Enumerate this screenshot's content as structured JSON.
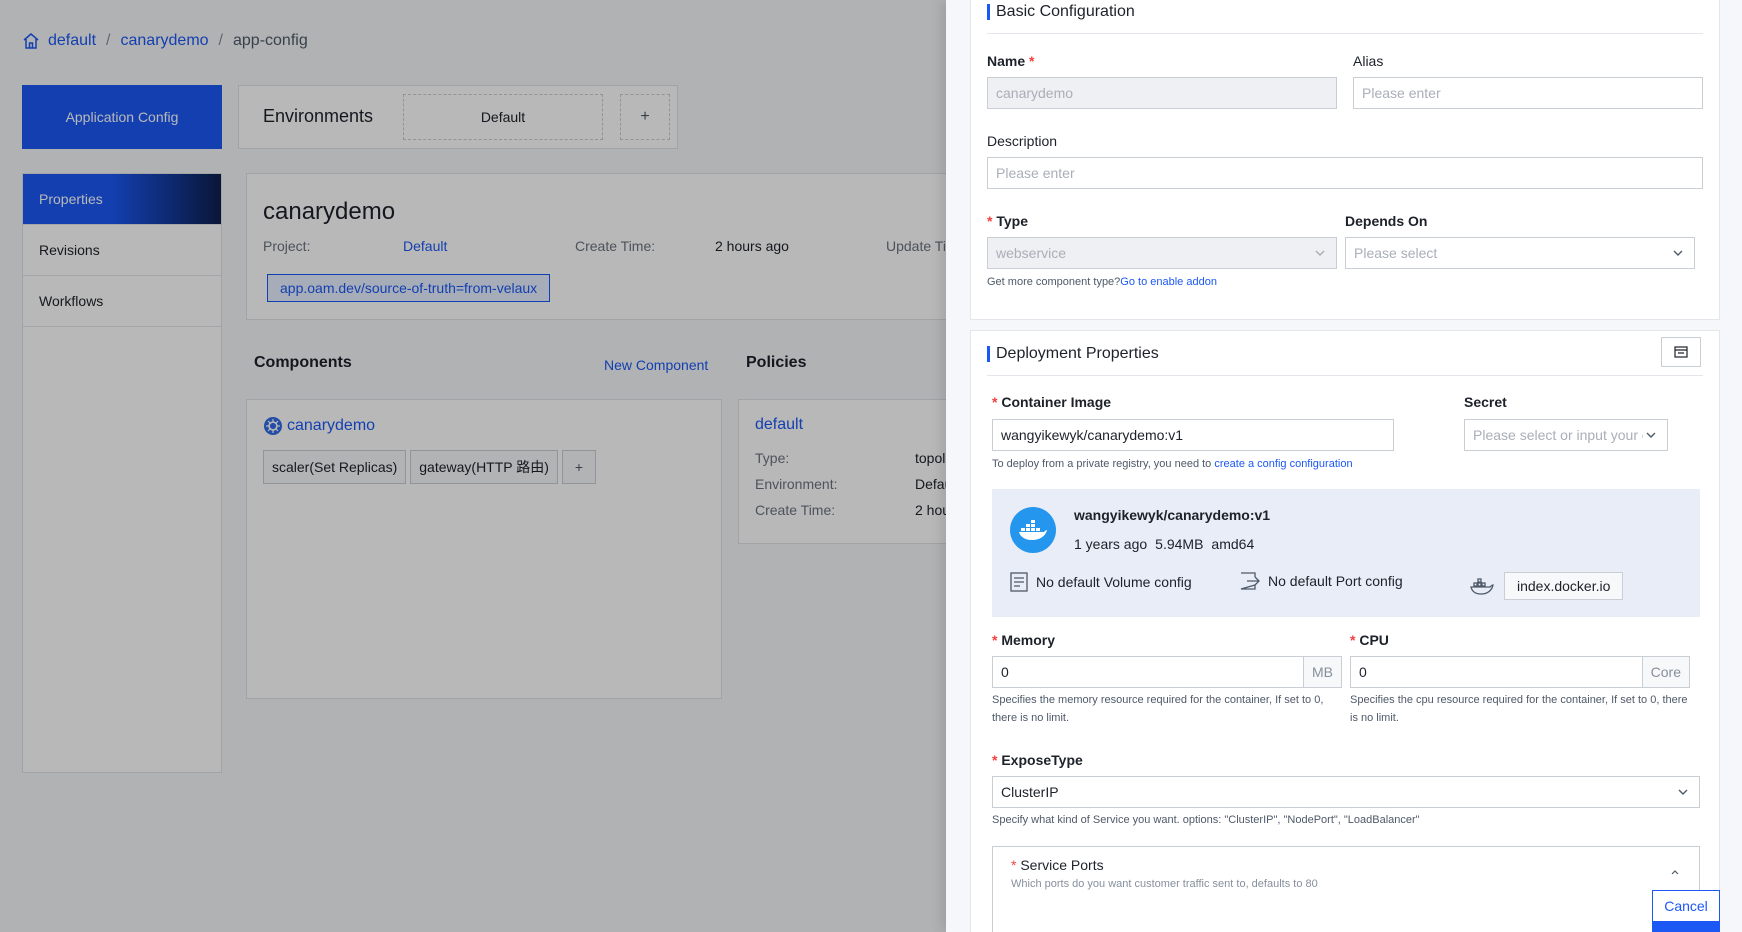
{
  "breadcrumb": {
    "items": [
      "default",
      "canarydemo",
      "app-config"
    ]
  },
  "nav": {
    "app_config": "Application Config",
    "environments_title": "Environments",
    "env_default": "Default",
    "add": "+"
  },
  "sidebar": {
    "items": [
      {
        "label": "Properties"
      },
      {
        "label": "Revisions"
      },
      {
        "label": "Workflows"
      }
    ]
  },
  "app_info": {
    "name": "canarydemo",
    "project_label": "Project:",
    "project_value": "Default",
    "create_label": "Create Time:",
    "create_value": "2 hours ago",
    "update_label": "Update Tim",
    "label_tag": "app.oam.dev/source-of-truth=from-velaux"
  },
  "components": {
    "title": "Components",
    "new_label": "New Component",
    "card": {
      "name": "canarydemo",
      "traits": [
        "scaler(Set Replicas)",
        "gateway(HTTP 路由)"
      ]
    }
  },
  "policies": {
    "title": "Policies",
    "card": {
      "name": "default",
      "type_label": "Type:",
      "type_value": "topol",
      "env_label": "Environment:",
      "env_value": "Defau",
      "create_label": "Create Time:",
      "create_value": "2 hou"
    }
  },
  "drawer": {
    "basic": {
      "title": "Basic Configuration",
      "name_label": "Name",
      "name_value": "canarydemo",
      "alias_label": "Alias",
      "alias_placeholder": "Please enter",
      "desc_label": "Description",
      "desc_placeholder": "Please enter",
      "type_label": "Type",
      "type_value": "webservice",
      "depends_label": "Depends On",
      "depends_placeholder": "Please select",
      "type_help": "Get more component type?",
      "type_help_link": "Go to enable addon"
    },
    "deploy": {
      "title": "Deployment Properties",
      "image_label": "Container Image",
      "image_value": "wangyikewyk/canarydemo:v1",
      "secret_label": "Secret",
      "secret_placeholder": "Please select or input your owne",
      "image_help": "To deploy from a private registry, you need to ",
      "image_help_link": "create a config configuration",
      "image_info": {
        "name": "wangyikewyk/canarydemo:v1",
        "age": "1 years ago",
        "size": "5.94MB",
        "arch": "amd64",
        "volume": "No default Volume config",
        "port": "No default Port config",
        "registry": "index.docker.io"
      },
      "memory_label": "Memory",
      "memory_value": "0",
      "memory_unit": "MB",
      "memory_help": "Specifies the memory resource required for the container, If set to 0, there is no limit.",
      "cpu_label": "CPU",
      "cpu_value": "0",
      "cpu_unit": "Core",
      "cpu_help": "Specifies the cpu resource required for the container, If set to 0, there is no limit.",
      "expose_label": "ExposeType",
      "expose_value": "ClusterIP",
      "expose_help": "Specify what kind of Service you want. options: \"ClusterIP\", \"NodePort\", \"LoadBalancer\"",
      "ports_label": "Service Ports",
      "ports_help": "Which ports do you want customer traffic sent to, defaults to 80"
    },
    "cancel": "Cancel"
  },
  "colors": {
    "primary": "#1b58f4",
    "required": "#f53f3f",
    "docker": "#2496ed"
  }
}
